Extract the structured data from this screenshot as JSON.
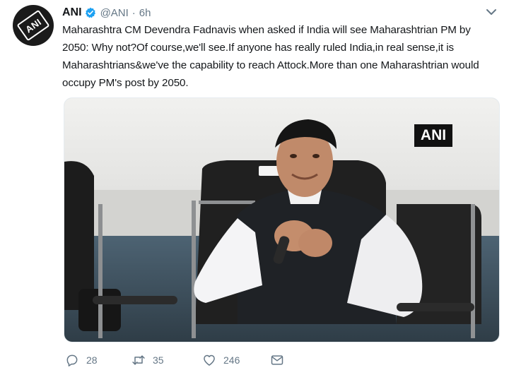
{
  "tweet": {
    "author_name": "ANI",
    "handle": "@ANI",
    "separator": "·",
    "time": "6h",
    "text": "Maharashtra CM Devendra Fadnavis when asked if India will see Maharashtrian PM by 2050: Why not?Of course,we'll see.If anyone has really ruled India,in real sense,it is Maharashtrians&we've the capability to reach Attock.More than one Maharashtrian would occupy PM's post by 2050.",
    "avatar_logo_text": "ANI",
    "media_watermark": "ANI",
    "media_nameplate_text": "",
    "actions": {
      "replies": "28",
      "retweets": "35",
      "likes": "246"
    }
  },
  "colors": {
    "text": "#14171a",
    "secondary": "#657786",
    "verified_blue": "#1da1f2"
  },
  "icons": {
    "verified": "verified-badge-icon",
    "caret": "chevron-down-icon",
    "reply": "reply-icon",
    "retweet": "retweet-icon",
    "like": "heart-icon",
    "dm": "envelope-icon"
  }
}
